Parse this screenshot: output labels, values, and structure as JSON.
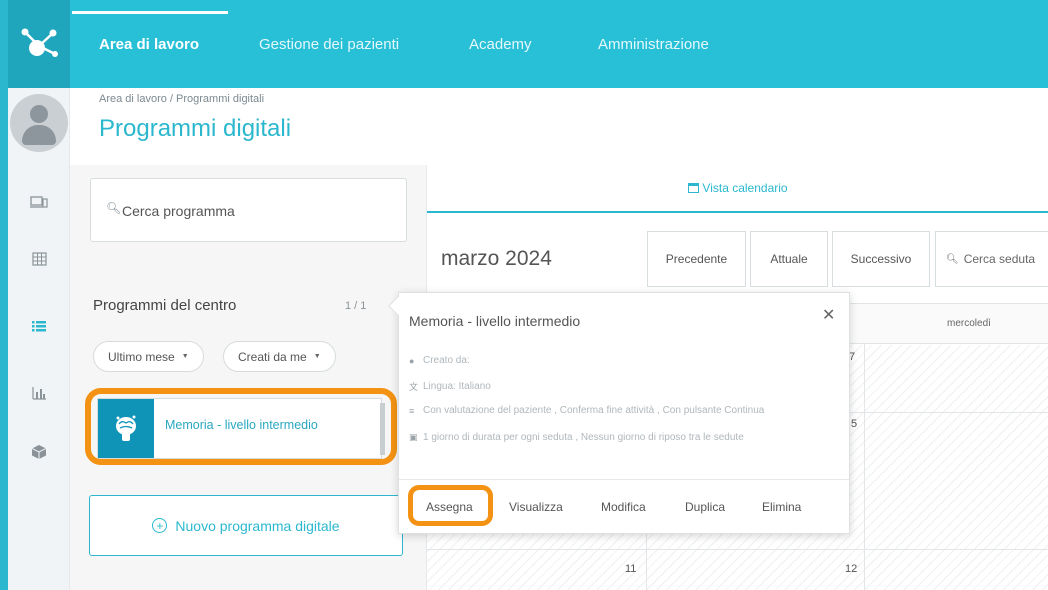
{
  "nav": {
    "items": [
      "Area di lavoro",
      "Gestione dei pazienti",
      "Academy",
      "Amministrazione"
    ]
  },
  "header": {
    "breadcrumb": "Area di lavoro / Programmi digitali",
    "title": "Programmi digitali"
  },
  "left_panel": {
    "search_placeholder": "Cerca programma",
    "list_title": "Programmi del centro",
    "list_count": "1 / 1",
    "filters": [
      "Ultimo mese",
      "Creati da me"
    ],
    "program_name": "Memoria - livello intermedio",
    "new_program_label": "Nuovo programma digitale"
  },
  "calendar": {
    "tab_label": "Vista calendario",
    "month": "marzo 2024",
    "buttons": [
      "Precedente",
      "Attuale",
      "Successivo"
    ],
    "search_placeholder": "Cerca seduta",
    "day_label": "mercoledì",
    "cell_numbers": [
      "7",
      "5",
      "11",
      "12"
    ]
  },
  "popover": {
    "title": "Memoria - livello intermedio",
    "created_by": "Creato da:",
    "language": "Lingua: Italiano",
    "options": "Con valutazione del paziente , Conferma fine attività , Con pulsante Continua",
    "duration": "1 giorno di durata per ogni seduta , Nessun giorno di riposo tra le sedute",
    "actions": [
      "Assegna",
      "Visualizza",
      "Modifica",
      "Duplica",
      "Elimina"
    ]
  },
  "colors": {
    "brand": "#28c0d7",
    "accent": "#2bb8cf",
    "highlight": "#f39213",
    "thumb": "#0f94b8"
  }
}
